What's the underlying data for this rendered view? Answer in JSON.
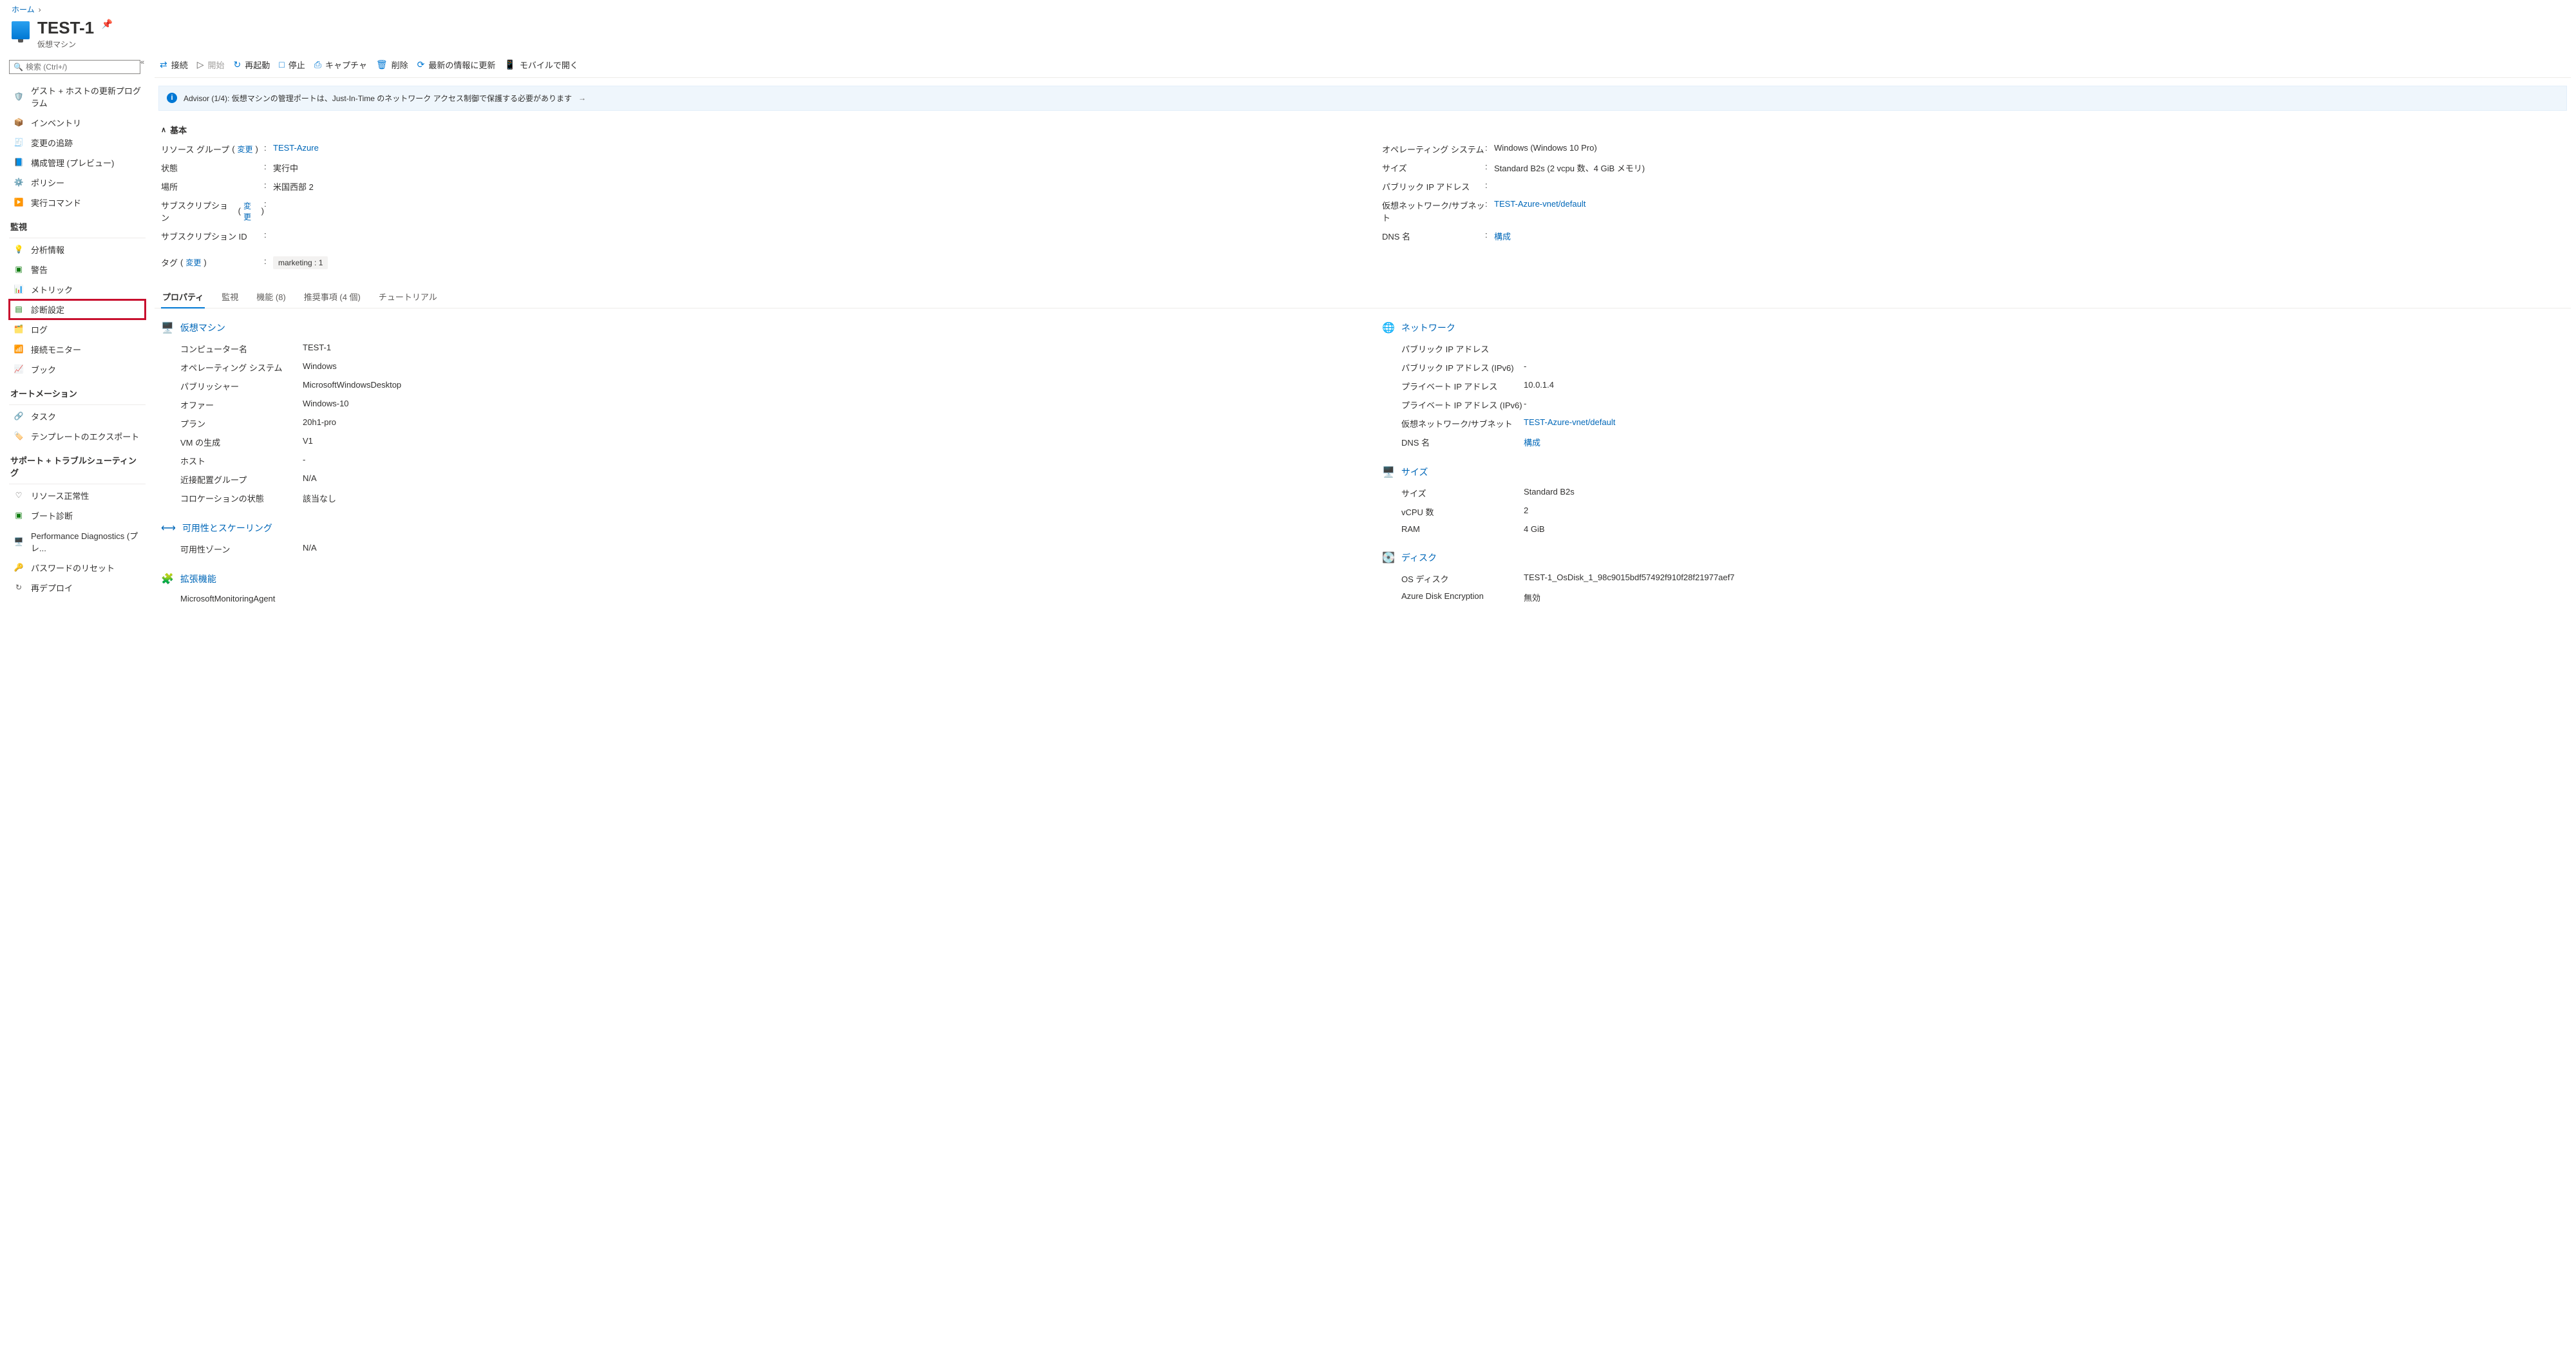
{
  "breadcrumb": {
    "home": "ホーム"
  },
  "header": {
    "title": "TEST-1",
    "subtype": "仮想マシン"
  },
  "sidebar": {
    "search_placeholder": "検索 (Ctrl+/)",
    "items_top": [
      {
        "label": "ゲスト + ホストの更新プログラム",
        "icon": "🛡️"
      },
      {
        "label": "インベントリ",
        "icon": "📦"
      },
      {
        "label": "変更の追跡",
        "icon": "🧾"
      },
      {
        "label": "構成管理 (プレビュー)",
        "icon": "📘"
      },
      {
        "label": "ポリシー",
        "icon": "⚙️"
      },
      {
        "label": "実行コマンド",
        "icon": "▶️"
      }
    ],
    "group_monitor": "監視",
    "items_monitor": [
      {
        "label": "分析情報",
        "icon": "💡"
      },
      {
        "label": "警告",
        "icon": "🟩"
      },
      {
        "label": "メトリック",
        "icon": "📊"
      },
      {
        "label": "診断設定",
        "icon": "📄",
        "highlighted": true
      },
      {
        "label": "ログ",
        "icon": "🗂️"
      },
      {
        "label": "接続モニター",
        "icon": "📶"
      },
      {
        "label": "ブック",
        "icon": "📈"
      }
    ],
    "group_automation": "オートメーション",
    "items_automation": [
      {
        "label": "タスク",
        "icon": "🔗"
      },
      {
        "label": "テンプレートのエクスポート",
        "icon": "📤"
      }
    ],
    "group_support": "サポート + トラブルシューティング",
    "items_support": [
      {
        "label": "リソース正常性",
        "icon": "♡"
      },
      {
        "label": "ブート診断",
        "icon": "🟩"
      },
      {
        "label": "Performance Diagnostics (プレ...",
        "icon": "🖥️"
      },
      {
        "label": "パスワードのリセット",
        "icon": "🔑"
      },
      {
        "label": "再デプロイ",
        "icon": "↻"
      }
    ]
  },
  "toolbar": {
    "connect": "接続",
    "start": "開始",
    "restart": "再起動",
    "stop": "停止",
    "capture": "キャプチャ",
    "delete": "削除",
    "refresh": "最新の情報に更新",
    "mobile": "モバイルで開く"
  },
  "advisor": {
    "prefix": "Advisor (1/4): ",
    "text": "仮想マシンの管理ポートは、Just-In-Time のネットワーク アクセス制御で保護する必要があります"
  },
  "essentials": {
    "header": "基本",
    "change": "変更",
    "left": {
      "resource_group_label": "リソース グループ",
      "resource_group_value": "TEST-Azure",
      "status_label": "状態",
      "status_value": "実行中",
      "location_label": "場所",
      "location_value": "米国西部 2",
      "subscription_label": "サブスクリプション",
      "subscription_id_label": "サブスクリプション ID",
      "tags_label": "タグ",
      "tags_value": "marketing : 1"
    },
    "right": {
      "os_label": "オペレーティング システム",
      "os_value": "Windows (Windows 10 Pro)",
      "size_label": "サイズ",
      "size_value": "Standard B2s (2 vcpu 数、4 GiB メモリ)",
      "pip_label": "パブリック IP アドレス",
      "vnet_label": "仮想ネットワーク/サブネット",
      "vnet_value": "TEST-Azure-vnet/default",
      "dns_label": "DNS 名",
      "dns_value": "構成"
    }
  },
  "tabs": {
    "properties": "プロパティ",
    "monitoring": "監視",
    "capabilities": "機能 (8)",
    "recommendations": "推奨事項 (4 個)",
    "tutorials": "チュートリアル"
  },
  "props": {
    "vm": {
      "header": "仮想マシン",
      "computer_name_l": "コンピューター名",
      "computer_name_v": "TEST-1",
      "os_l": "オペレーティング システム",
      "os_v": "Windows",
      "publisher_l": "パブリッシャー",
      "publisher_v": "MicrosoftWindowsDesktop",
      "offer_l": "オファー",
      "offer_v": "Windows-10",
      "plan_l": "プラン",
      "plan_v": "20h1-pro",
      "gen_l": "VM の生成",
      "gen_v": "V1",
      "host_l": "ホスト",
      "host_v": "-",
      "ppg_l": "近接配置グループ",
      "ppg_v": "N/A",
      "colo_l": "コロケーションの状態",
      "colo_v": "該当なし"
    },
    "avail": {
      "header": "可用性とスケーリング",
      "zone_l": "可用性ゾーン",
      "zone_v": "N/A"
    },
    "ext": {
      "header": "拡張機能",
      "agent": "MicrosoftMonitoringAgent"
    },
    "net": {
      "header": "ネットワーク",
      "pip_l": "パブリック IP アドレス",
      "pip_v": "",
      "pip6_l": "パブリック IP アドレス (IPv6)",
      "pip6_v": "-",
      "prip_l": "プライベート IP アドレス",
      "prip_v": "10.0.1.4",
      "prip6_l": "プライベート IP アドレス (IPv6)",
      "prip6_v": "-",
      "vnet_l": "仮想ネットワーク/サブネット",
      "vnet_v": "TEST-Azure-vnet/default",
      "dns_l": "DNS 名",
      "dns_v": "構成"
    },
    "size": {
      "header": "サイズ",
      "size_l": "サイズ",
      "size_v": "Standard B2s",
      "vcpu_l": "vCPU 数",
      "vcpu_v": "2",
      "ram_l": "RAM",
      "ram_v": "4 GiB"
    },
    "disk": {
      "header": "ディスク",
      "os_l": "OS ディスク",
      "os_v": "TEST-1_OsDisk_1_98c9015bdf57492f910f28f21977aef7",
      "enc_l": "Azure Disk Encryption",
      "enc_v": "無効"
    }
  }
}
